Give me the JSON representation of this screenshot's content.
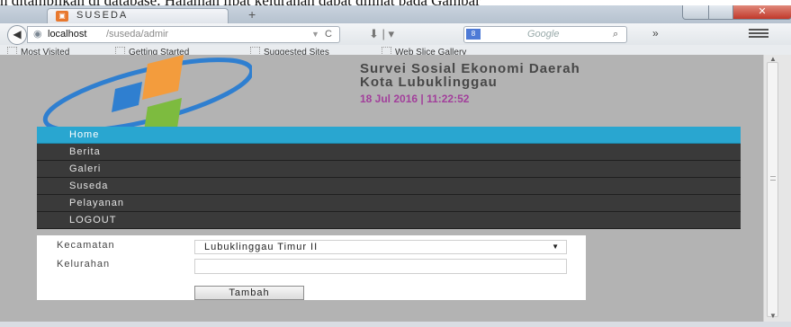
{
  "doc_text": "n ditampilkan di database. Halaman lipat kelurahan dapat dilihat pada Gambar",
  "browser": {
    "tab_title": "SUSEDA",
    "new_tab_label": "+",
    "url_host": "localhost",
    "url_path": "/suseda/admir",
    "search_placeholder": "Google",
    "bookmarks": [
      "Most Visited",
      "Getting Started",
      "Suggested Sites",
      "Web Slice Gallery"
    ]
  },
  "header": {
    "title_line1": "Survei Sosial Ekonomi Daerah",
    "title_line2": "Kota Lubuklinggau",
    "datetime": "18 Jul 2016 | 11:22:52"
  },
  "menu": {
    "items": [
      "Home",
      "Berita",
      "Galeri",
      "Suseda",
      "Pelayanan",
      "LOGOUT"
    ],
    "active_index": 0
  },
  "form": {
    "kecamatan_label": "Kecamatan",
    "kecamatan_value": "Lubuklinggau Timur II",
    "kelurahan_label": "Kelurahan",
    "kelurahan_value": "",
    "submit_label": "Tambah"
  },
  "colors": {
    "menu_active": "#29a6d0",
    "menu_bg": "#3a3a3a",
    "date_color": "#a23f9b",
    "page_bg": "#b3b3b3"
  },
  "icons": [
    "firefox-tab-icon",
    "back-arrow-icon",
    "globe-icon",
    "reload-icon",
    "download-icon",
    "search-icon",
    "chevron-right-icon",
    "menu-icon",
    "bookmark-folder-icon",
    "bps-logo"
  ]
}
